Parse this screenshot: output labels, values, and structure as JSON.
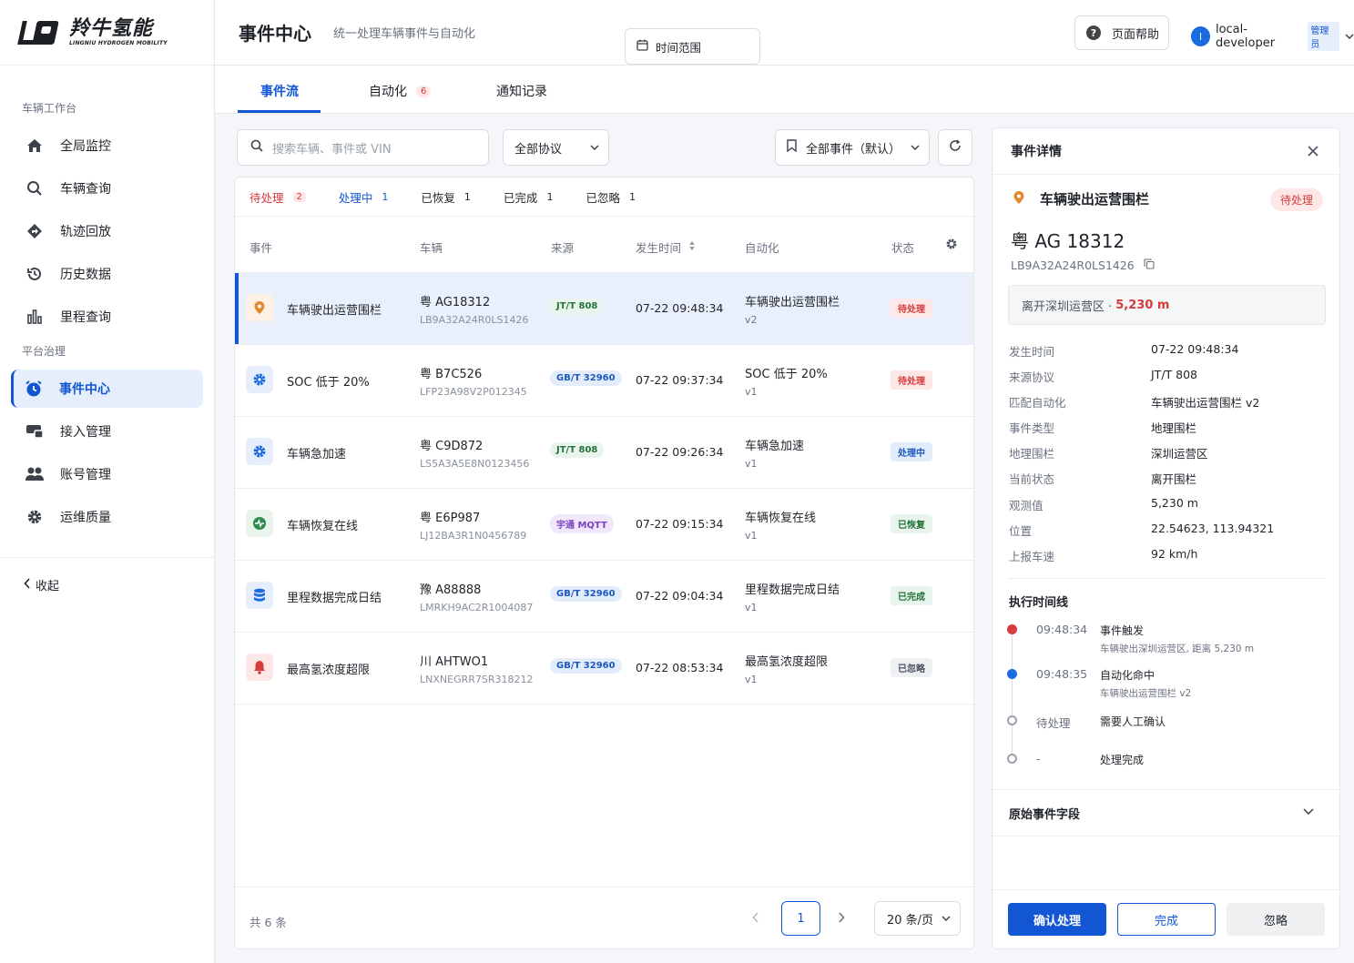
{
  "brand": {
    "name_cn": "羚牛氢能",
    "name_en": "LINGNIU HYDROGEN MOBILITY"
  },
  "sidebar": {
    "group1": "车辆工作台",
    "group2": "平台治理",
    "items": [
      {
        "label": "全局监控",
        "icon": "home-icon"
      },
      {
        "label": "车辆查询",
        "icon": "search-icon"
      },
      {
        "label": "轨迹回放",
        "icon": "route-icon"
      },
      {
        "label": "历史数据",
        "icon": "history-icon"
      },
      {
        "label": "里程查询",
        "icon": "bar-chart-icon"
      },
      {
        "label": "事件中心",
        "icon": "alarm-clock-icon",
        "active": true
      },
      {
        "label": "接入管理",
        "icon": "device-icon"
      },
      {
        "label": "账号管理",
        "icon": "users-icon"
      },
      {
        "label": "运维质量",
        "icon": "gear-icon"
      }
    ],
    "collapse": "收起"
  },
  "header": {
    "title": "事件中心",
    "subtitle": "统一处理车辆事件与自动化",
    "help": "页面帮助",
    "user_initial": "l",
    "user_name": "local-developer",
    "user_role": "管理员"
  },
  "tabs": [
    {
      "label": "事件流",
      "active": true
    },
    {
      "label": "自动化",
      "count": "6"
    },
    {
      "label": "通知记录"
    }
  ],
  "filters": {
    "search_placeholder": "搜索车辆、事件或 VIN",
    "protocol": "全部协议",
    "time_range": "时间范围",
    "saved_view": "全部事件（默认）"
  },
  "status_tabs": [
    {
      "label": "待处理",
      "count": "2"
    },
    {
      "label": "处理中",
      "count": "1"
    },
    {
      "label": "已恢复",
      "count": "1"
    },
    {
      "label": "已完成",
      "count": "1"
    },
    {
      "label": "已忽略",
      "count": "1"
    }
  ],
  "columns": {
    "event": "事件",
    "vehicle": "车辆",
    "source": "来源",
    "time": "发生时间",
    "automation": "自动化",
    "status": "状态"
  },
  "rows": [
    {
      "event": "车辆驶出运营围栏",
      "icon": "location-pin-icon",
      "plate": "粤 AG18312",
      "vin": "LB9A32A24R0LS1426",
      "source": "JT/T 808",
      "time": "07-22 09:48:34",
      "auto": "车辆驶出运营围栏",
      "ver": "v2",
      "status": "待处理"
    },
    {
      "event": "SOC 低于 20%",
      "icon": "gear-icon",
      "plate": "粤 B7C526",
      "vin": "LFP23A98V2P012345",
      "source": "GB/T 32960",
      "time": "07-22 09:37:34",
      "auto": "SOC 低于 20%",
      "ver": "v1",
      "status": "待处理"
    },
    {
      "event": "车辆急加速",
      "icon": "gear-icon",
      "plate": "粤 C9D872",
      "vin": "LS5A3A5E8N0123456",
      "source": "JT/T 808",
      "time": "07-22 09:26:34",
      "auto": "车辆急加速",
      "ver": "v1",
      "status": "处理中"
    },
    {
      "event": "车辆恢复在线",
      "icon": "heartbeat-icon",
      "plate": "粤 E6P987",
      "vin": "LJ12BA3R1N0456789",
      "source": "宇通 MQTT",
      "time": "07-22 09:15:34",
      "auto": "车辆恢复在线",
      "ver": "v1",
      "status": "已恢复"
    },
    {
      "event": "里程数据完成日结",
      "icon": "database-icon",
      "plate": "豫 A88888",
      "vin": "LMRKH9AC2R1004087",
      "source": "GB/T 32960",
      "time": "07-22 09:04:34",
      "auto": "里程数据完成日结",
      "ver": "v1",
      "status": "已完成"
    },
    {
      "event": "最高氢浓度超限",
      "icon": "bell-alert-icon",
      "plate": "川 AHTWO1",
      "vin": "LNXNEGRR7SR318212",
      "source": "GB/T 32960",
      "time": "07-22 08:53:34",
      "auto": "最高氢浓度超限",
      "ver": "v1",
      "status": "已忽略"
    }
  ],
  "footer": {
    "total": "共 6 条",
    "page": "1",
    "page_size": "20 条/页"
  },
  "detail": {
    "title": "事件详情",
    "event": "车辆驶出运营围栏",
    "status": "待处理",
    "plate": "粤 AG 18312",
    "vin": "LB9A32A24R0LS1426",
    "alert_text": "离开深圳运营区 ·",
    "alert_value": "5,230 m",
    "fields": [
      {
        "k": "发生时间",
        "v": "07-22 09:48:34"
      },
      {
        "k": "来源协议",
        "v": "JT/T 808"
      },
      {
        "k": "匹配自动化",
        "v": "车辆驶出运营围栏 v2"
      },
      {
        "k": "事件类型",
        "v": "地理围栏"
      },
      {
        "k": "地理围栏",
        "v": "深圳运营区"
      },
      {
        "k": "当前状态",
        "v": "离开围栏"
      },
      {
        "k": "观测值",
        "v": "5,230 m"
      },
      {
        "k": "位置",
        "v": "22.54623, 113.94321"
      },
      {
        "k": "上报车速",
        "v": "92 km/h"
      }
    ],
    "timeline_title": "执行时间线",
    "timeline": [
      {
        "time": "09:48:34",
        "event": "事件触发",
        "sub": "车辆驶出深圳运营区, 距离 5,230 m",
        "color": "#d83b3b"
      },
      {
        "time": "09:48:35",
        "event": "自动化命中",
        "sub": "车辆驶出运营围栏 v2",
        "color": "#1a6be0"
      },
      {
        "time": "待处理",
        "event": "需要人工确认",
        "sub": "",
        "color": "#9aa1ab"
      },
      {
        "time": "-",
        "event": "处理完成",
        "sub": "",
        "color": "#9aa1ab"
      }
    ],
    "raw_fields": "原始事件字段",
    "btn_confirm": "确认处理",
    "btn_done": "完成",
    "btn_ignore": "忽略"
  }
}
